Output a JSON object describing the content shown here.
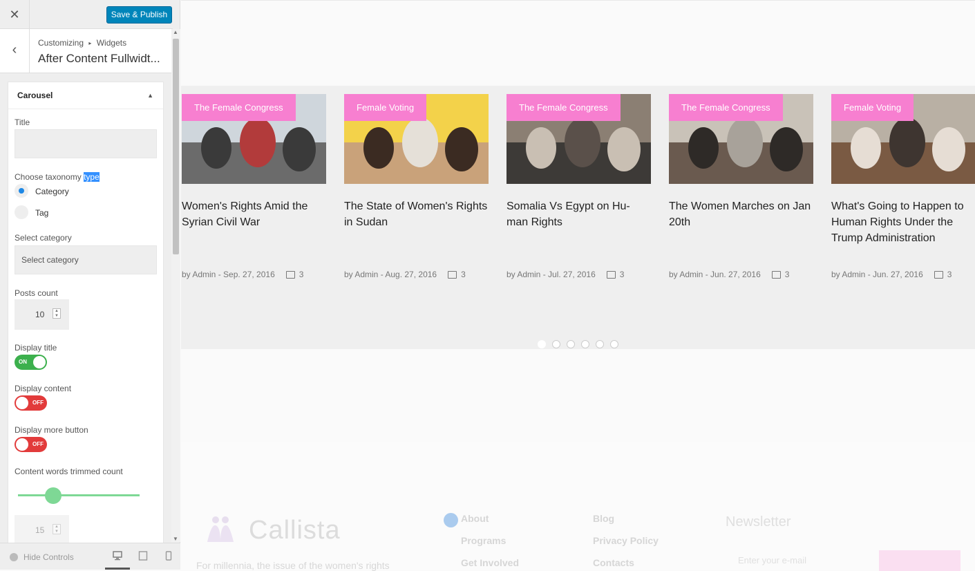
{
  "customizer": {
    "close_label": "✕",
    "save_label": "Save & Publish",
    "back_label": "‹",
    "breadcrumb_1": "Customizing",
    "breadcrumb_sep": "▸",
    "breadcrumb_2": "Widgets",
    "panel_title": "After Content Fullwidt...",
    "widget_name": "Carousel",
    "widget_toggle": "▲",
    "title_label": "Title",
    "title_value": "",
    "taxonomy_label_prefix": "Choose taxonomy ",
    "taxonomy_label_highlight": "type",
    "taxonomy_options": [
      {
        "label": "Category",
        "selected": true
      },
      {
        "label": "Tag",
        "selected": false
      }
    ],
    "select_category_label": "Select category",
    "select_category_value": "Select category",
    "posts_count_label": "Posts count",
    "posts_count_value": "10",
    "display_title_label": "Display title",
    "display_title_state": "ON",
    "display_content_label": "Display content",
    "display_content_state": "OFF",
    "display_more_label": "Display more button",
    "display_more_state": "OFF",
    "words_trimmed_label": "Content words trimmed count",
    "words_trimmed_value": "15",
    "words_trimmed_slider_fraction": 0.27,
    "hide_controls_label": "Hide Controls",
    "spin_up": "▲",
    "spin_down": "▼"
  },
  "carousel": {
    "cards": [
      {
        "badge": "The Female Congress",
        "title": "Women's Rights Amid the Syrian Civil War",
        "meta": "by Admin - Sep. 27, 2016",
        "comments": "3"
      },
      {
        "badge": "Female Voting",
        "title": "The State of Women's Rights in Sudan",
        "meta": "by Admin - Aug. 27, 2016",
        "comments": "3"
      },
      {
        "badge": "The Female Congress",
        "title": "Somalia Vs Egypt on Hu-man Rights",
        "meta": "by Admin - Jul. 27, 2016",
        "comments": "3"
      },
      {
        "badge": "The Female Congress",
        "title": "The Women Marches on Jan 20th",
        "meta": "by Admin - Jun. 27, 2016",
        "comments": "3"
      },
      {
        "badge": "Female Voting",
        "title": "What's Going to Happen to Human Rights Under the Trump Administration",
        "meta": "by Admin - Jun. 27, 2016",
        "comments": "3"
      }
    ],
    "page_count": 6,
    "active_page": 1,
    "badge_color": "#f77fd0"
  },
  "site_footer": {
    "brand": "Callista",
    "tagline": "For millennia, the issue of the women's rights",
    "links_col1": [
      "About",
      "Programs",
      "Get Involved"
    ],
    "links_col2": [
      "Blog",
      "Privacy Policy",
      "Contacts"
    ],
    "newsletter_title": "Newsletter",
    "newsletter_placeholder": "Enter your e-mail"
  }
}
